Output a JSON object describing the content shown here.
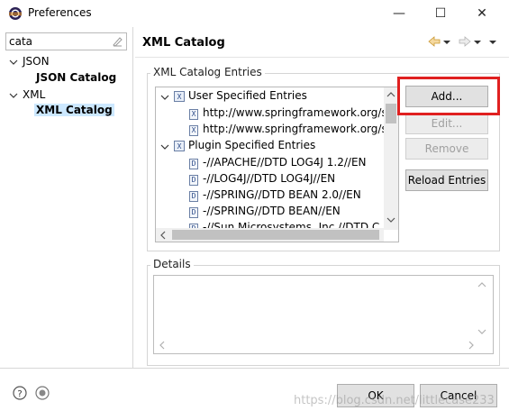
{
  "window": {
    "title": "Preferences",
    "min_glyph": "—",
    "max_glyph": "☐",
    "close_glyph": "✕"
  },
  "filter": {
    "value": "cata"
  },
  "tree": {
    "json_label": "JSON",
    "json_child": "JSON Catalog",
    "xml_label": "XML",
    "xml_child": "XML Catalog"
  },
  "page": {
    "title": "XML Catalog",
    "entries_group": "XML Catalog Entries",
    "details_group": "Details"
  },
  "entries": {
    "user_header": "User Specified Entries",
    "user_items": [
      "http://www.springframework.org/s",
      "http://www.springframework.org/s"
    ],
    "plugin_header": "Plugin Specified Entries",
    "plugin_items": [
      "-//APACHE//DTD LOG4J 1.2//EN",
      "-//LOG4J//DTD LOG4J//EN",
      "-//SPRING//DTD BEAN 2.0//EN",
      "-//SPRING//DTD BEAN//EN",
      "-//Sun Microsystems, Inc.//DTD C"
    ]
  },
  "buttons": {
    "add": "Add...",
    "edit": "Edit...",
    "remove": "Remove",
    "reload": "Reload Entries",
    "ok": "OK",
    "cancel": "Cancel"
  },
  "watermark": "https://blog.csdn.net/littlecase233",
  "colors": {
    "highlight": "#e02020",
    "selection": "#cce8ff"
  }
}
